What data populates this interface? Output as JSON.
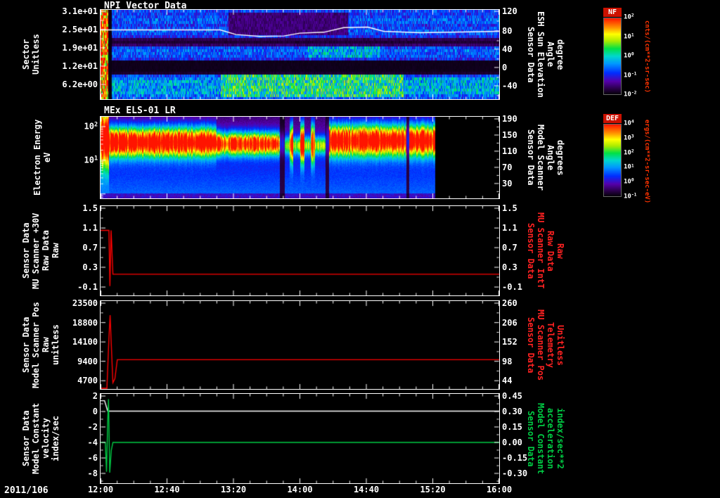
{
  "date_label": "2011/106",
  "time_axis": {
    "start": "12:00",
    "end": "16:00",
    "tick_labels": [
      "12:00",
      "12:40",
      "13:20",
      "14:00",
      "14:40",
      "15:20",
      "16:00"
    ]
  },
  "colorbars": [
    {
      "name": "NF",
      "unit_label": "cnts/(cm**2-sr-sec)",
      "tick_labels": [
        "10^2",
        "10^1",
        "10^0",
        "10^-1",
        "10^-2"
      ],
      "badge_bg": "#cc1100",
      "unit_color": "#ff3300"
    },
    {
      "name": "DEF",
      "unit_label": "ergs/(cm**2-sr-sec-eV)",
      "tick_labels": [
        "10^4",
        "10^3",
        "10^2",
        "10^1",
        "10^0",
        "10^-1"
      ],
      "badge_bg": "#cc1100",
      "unit_color": "#ff3300"
    }
  ],
  "chart_data": [
    {
      "key": "npi",
      "type": "heatmap",
      "title": "NPI Vector Data",
      "left_label": "Sector\nUnitless",
      "right_label": "Sensor Data\nESH Sun Elevation\nAngle\ndegree",
      "right_label_color": "#ffffff",
      "left_ticks": [
        {
          "label": "3.1e+01",
          "f": 0.016
        },
        {
          "label": "2.5e+01",
          "f": 0.221
        },
        {
          "label": "1.9e+01",
          "f": 0.425
        },
        {
          "label": "1.2e+01",
          "f": 0.63
        },
        {
          "label": "6.2e+00",
          "f": 0.835
        }
      ],
      "right_ticks": [
        {
          "label": "120",
          "f": 0.016
        },
        {
          "label": "80",
          "f": 0.236
        },
        {
          "label": "40",
          "f": 0.44
        },
        {
          "label": "0",
          "f": 0.645
        },
        {
          "label": "-40",
          "f": 0.85
        }
      ],
      "right_axis": {
        "v0": 120,
        "f0": 0.016,
        "v1": -40,
        "f1": 0.85
      },
      "rows": [
        0.3,
        0.28,
        0.3,
        0.34,
        0.32,
        0.28,
        0.3,
        0.32,
        0.3,
        0.26,
        0.08,
        0.05,
        0.1,
        0.3,
        0.34,
        0.32,
        0.3,
        0.26,
        0.02,
        0.02,
        0.02,
        0.02,
        0.04,
        0.3,
        0.36,
        0.4,
        0.44,
        0.46,
        0.44,
        0.4,
        0.36,
        0.32
      ],
      "patches": [
        [
          0,
          0.018,
          0,
          32,
          0.92
        ],
        [
          0.018,
          0.027,
          0,
          32,
          0.01
        ],
        [
          0.32,
          0.62,
          1,
          9,
          0.12
        ],
        [
          0.05,
          0.3,
          25,
          30,
          0.42
        ],
        [
          0.3,
          0.76,
          23,
          31,
          0.55
        ],
        [
          0.78,
          1.0,
          24,
          30,
          0.44
        ],
        [
          0.52,
          0.7,
          13,
          17,
          0.44
        ]
      ],
      "overlay_line": {
        "name": "ESH Sun Elevation Angle (degrees)",
        "color": "#ffffff",
        "points": [
          [
            0,
            80
          ],
          [
            0.3,
            80
          ],
          [
            0.34,
            70
          ],
          [
            0.4,
            66
          ],
          [
            0.46,
            67
          ],
          [
            0.5,
            73
          ],
          [
            0.56,
            75
          ],
          [
            0.61,
            85
          ],
          [
            0.67,
            86
          ],
          [
            0.71,
            77
          ],
          [
            0.8,
            74
          ],
          [
            0.88,
            75
          ],
          [
            1,
            77
          ]
        ]
      }
    },
    {
      "key": "els",
      "type": "heatmap",
      "log_axis": true,
      "title": "MEx ELS-01 LR",
      "left_label": "Electron Energy\neV",
      "right_label": "Sensor Data\nModel Scanner\nAngle\ndegrees",
      "right_label_color": "#ffffff",
      "left_ticks": [
        {
          "label": "10^2",
          "f": 0.12
        },
        {
          "label": "10^1",
          "f": 0.534
        }
      ],
      "right_ticks": [
        {
          "label": "190",
          "f": 0.026
        },
        {
          "label": "150",
          "f": 0.224
        },
        {
          "label": "110",
          "f": 0.422
        },
        {
          "label": "70",
          "f": 0.62
        },
        {
          "label": "30",
          "f": 0.818
        }
      ],
      "e_top": 2.29,
      "e_span": 2.42,
      "data_end": 0.838,
      "segments": [
        [
          0,
          0.02,
          0.95,
          1.7,
          0.9
        ],
        [
          0.02,
          0.29,
          1.0,
          1.55,
          0.42
        ],
        [
          0.29,
          0.46,
          0.9,
          1.5,
          0.32
        ],
        [
          0.46,
          0.565,
          0.5,
          1.45,
          0.26
        ],
        [
          0.565,
          0.838,
          1.0,
          1.6,
          0.45
        ]
      ],
      "streaks": [
        [
          0.478,
          0.95
        ],
        [
          0.505,
          1.0
        ],
        [
          0.532,
          0.9
        ]
      ],
      "gaps": [
        [
          0.455,
          0.006
        ],
        [
          0.568,
          0.005
        ],
        [
          0.77,
          0.004
        ]
      ]
    },
    {
      "key": "mu-scanner-30v",
      "type": "line",
      "left_label": "Sensor Data\nMU Scanner +30V\nRaw Data\nRaw",
      "right_label": "Sensor Data\nMU Scanner IntT\nRaw Data\nRaw",
      "right_label_color": "#ff2222",
      "left_ticks": [
        {
          "label": "1.5",
          "f": 0.024
        },
        {
          "label": "1.1",
          "f": 0.245
        },
        {
          "label": "0.7",
          "f": 0.465
        },
        {
          "label": "0.3",
          "f": 0.685
        },
        {
          "label": "-0.1",
          "f": 0.906
        }
      ],
      "right_ticks": [
        {
          "label": "1.5",
          "f": 0.024
        },
        {
          "label": "1.1",
          "f": 0.245
        },
        {
          "label": "0.7",
          "f": 0.465
        },
        {
          "label": "0.3",
          "f": 0.685
        },
        {
          "label": "-0.1",
          "f": 0.906
        }
      ],
      "y_axis": {
        "v0": 1.5,
        "f0": 0.024,
        "v1": -0.1,
        "f1": 0.906
      },
      "series": [
        {
          "name": "MU Scanner +30V Raw Data",
          "color": "#ff0000",
          "points": [
            [
              0,
              1.05
            ],
            [
              0.021,
              1.05
            ],
            [
              0.0235,
              -0.08
            ],
            [
              0.0265,
              1.05
            ],
            [
              0.031,
              0.16
            ],
            [
              1,
              0.16
            ]
          ]
        }
      ]
    },
    {
      "key": "model-scanner-pos",
      "type": "line",
      "left_label": "Sensor Data\nModel Scanner Pos\nRaw\nunitless",
      "right_label": "Sensor Data\nMU Scanner Pos\nTelemetry\nUnitless",
      "right_label_color": "#ff2222",
      "left_ticks": [
        {
          "label": "23500",
          "f": 0.024
        },
        {
          "label": "18800",
          "f": 0.245
        },
        {
          "label": "14100",
          "f": 0.465
        },
        {
          "label": "9400",
          "f": 0.685
        },
        {
          "label": "4700",
          "f": 0.906
        }
      ],
      "right_ticks": [
        {
          "label": "260",
          "f": 0.024
        },
        {
          "label": "206",
          "f": 0.245
        },
        {
          "label": "152",
          "f": 0.465
        },
        {
          "label": "98",
          "f": 0.685
        },
        {
          "label": "44",
          "f": 0.906
        }
      ],
      "y_axis": {
        "v0": 23500,
        "f0": 0.024,
        "v1": 4700,
        "f1": 0.906
      },
      "series": [
        {
          "name": "Model Scanner Pos Raw",
          "color": "#ff0000",
          "points": [
            [
              0,
              2600
            ],
            [
              0.016,
              2600
            ],
            [
              0.021,
              15000
            ],
            [
              0.024,
              20600
            ],
            [
              0.028,
              11000
            ],
            [
              0.031,
              4200
            ],
            [
              0.036,
              5200
            ],
            [
              0.042,
              9800
            ],
            [
              1,
              9800
            ]
          ]
        }
      ]
    },
    {
      "key": "model-constant",
      "type": "line",
      "left_label": "Sensor Data\nModel Constant\nvelocity\nindex/sec",
      "right_label": "Sensor Data\nModel Constant\nacceleration\nindex/sec**2",
      "right_label_color": "#00cc44",
      "left_ticks": [
        {
          "label": "2",
          "f": 0.024
        },
        {
          "label": "0",
          "f": 0.197
        },
        {
          "label": "-2",
          "f": 0.37
        },
        {
          "label": "-4",
          "f": 0.543
        },
        {
          "label": "-6",
          "f": 0.717
        },
        {
          "label": "-8",
          "f": 0.89
        }
      ],
      "right_ticks": [
        {
          "label": "0.45",
          "f": 0.024
        },
        {
          "label": "0.30",
          "f": 0.197
        },
        {
          "label": "0.15",
          "f": 0.37
        },
        {
          "label": "0.00",
          "f": 0.543
        },
        {
          "label": "-0.15",
          "f": 0.717
        },
        {
          "label": "-0.30",
          "f": 0.89
        }
      ],
      "y_axis": {
        "v0": 2,
        "f0": 0.024,
        "v1": -8,
        "f1": 0.89
      },
      "series": [
        {
          "name": "Model Constant velocity",
          "color": "#ffffff",
          "points": [
            [
              0,
              1.4
            ],
            [
              0.01,
              1.4
            ],
            [
              0.018,
              0.05
            ],
            [
              1,
              0.05
            ]
          ]
        },
        {
          "name": "Model Constant acceleration",
          "color": "#00cc44",
          "points": [
            [
              0,
              -4
            ],
            [
              0.012,
              -4
            ],
            [
              0.015,
              -7.8
            ],
            [
              0.018,
              -1.2
            ],
            [
              0.02,
              1.6
            ],
            [
              0.023,
              -7.9
            ],
            [
              0.027,
              -5
            ],
            [
              0.031,
              -4
            ],
            [
              1,
              -4
            ]
          ]
        }
      ]
    }
  ]
}
